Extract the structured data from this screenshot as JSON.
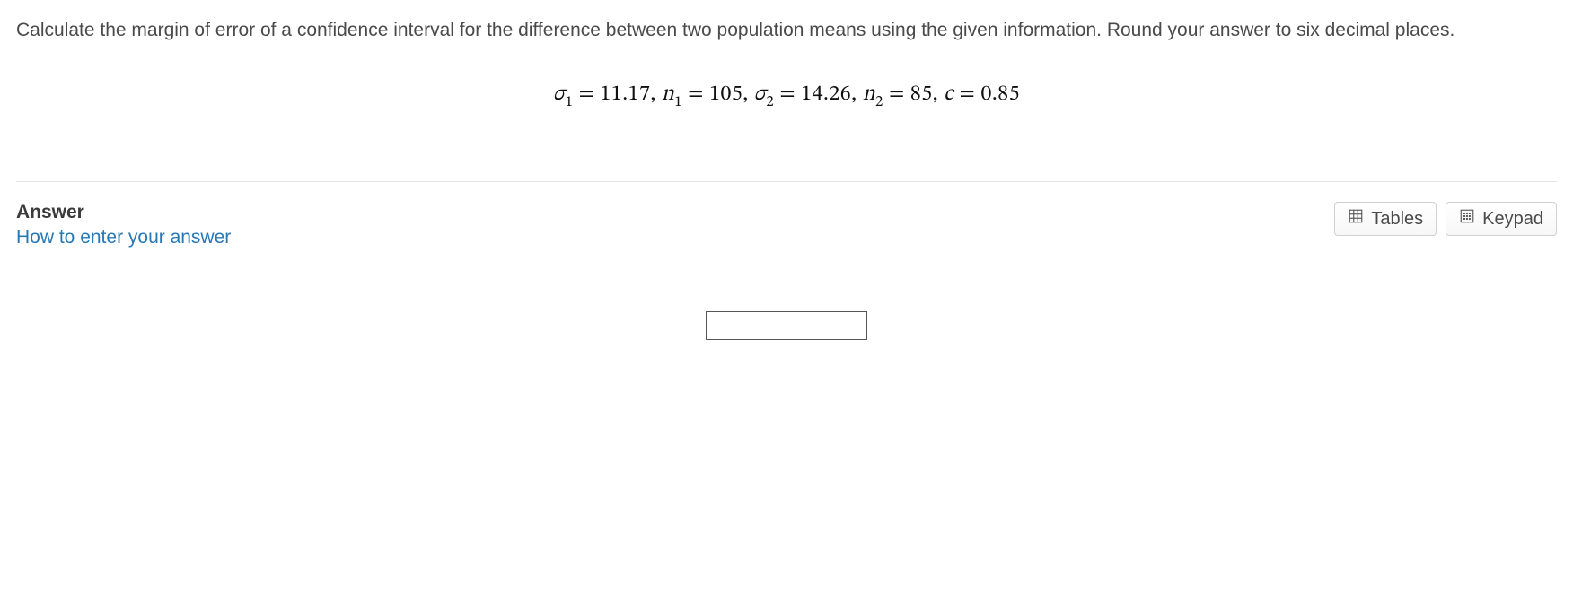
{
  "question": {
    "text": "Calculate the margin of error of a confidence interval for the difference between two population means using the given information. Round your answer to six decimal places.",
    "params": {
      "sigma1": "11.17",
      "n1": "105",
      "sigma2": "14.26",
      "n2": "85",
      "c": "0.85"
    }
  },
  "answer": {
    "heading": "Answer",
    "how_link": "How to enter your answer",
    "input_value": ""
  },
  "buttons": {
    "tables": "Tables",
    "keypad": "Keypad"
  }
}
